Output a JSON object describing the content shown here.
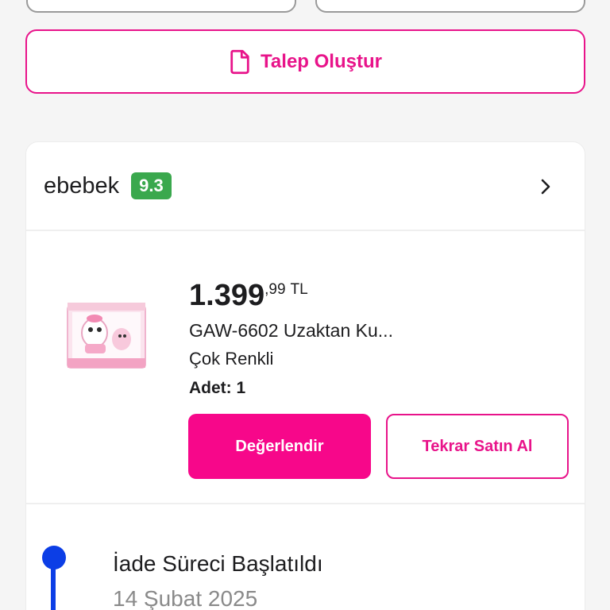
{
  "actions": {
    "talep_label": "Talep Oluştur",
    "talep_icon": "document-icon"
  },
  "seller": {
    "name": "ebebek",
    "score": "9.3",
    "score_color": "#3aa84d"
  },
  "product": {
    "price_main": "1.399",
    "price_decimal": ",99",
    "currency": "TL",
    "name": "GAW-6602 Uzaktan Ku...",
    "color": "Çok Renkli",
    "quantity": "Adet: 1",
    "rate_label": "Değerlendir",
    "rebuy_label": "Tekrar Satın Al"
  },
  "timeline": {
    "title": "İade Süreci Başlatıldı",
    "date": "14 Şubat 2025"
  },
  "colors": {
    "accent": "#e8138a",
    "accent_fill": "#f7078a",
    "timeline_blue": "#0c3ee6"
  }
}
